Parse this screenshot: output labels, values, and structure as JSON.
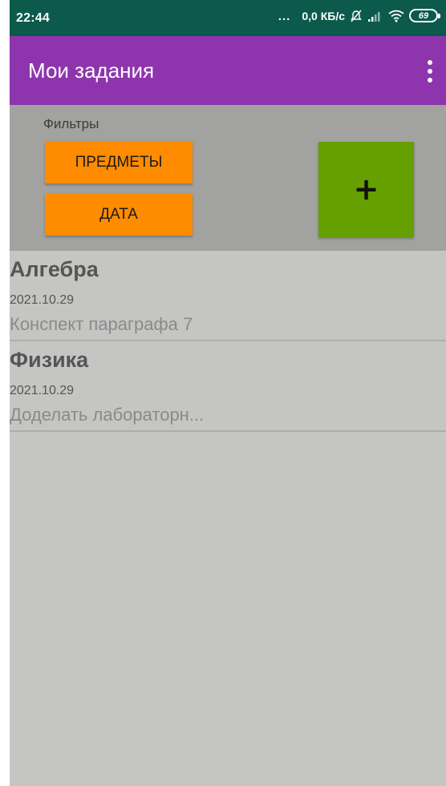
{
  "status_bar": {
    "time": "22:44",
    "more_dots": "...",
    "network_speed": "0,0 КБ/с",
    "battery_level": "69"
  },
  "app_bar": {
    "title": "Мои задания",
    "overflow_icon": "more-vert-icon"
  },
  "filters": {
    "label": "Фильтры",
    "subjects_button": "ПРЕДМЕТЫ",
    "date_button": "ДАТА",
    "add_button": "+"
  },
  "tasks": [
    {
      "subject": "Алгебра",
      "date": "2021.10.29",
      "description": "Конспект параграфа 7"
    },
    {
      "subject": "Физика",
      "date": "2021.10.29",
      "description": "Доделать лабораторн..."
    }
  ],
  "colors": {
    "status_bar": "#0c5a4c",
    "app_bar": "#8e35ad",
    "filter_panel": "#a2a2a1",
    "list_background": "#c5c5c3",
    "filter_button": "#ff8c00",
    "add_button": "#659f00"
  }
}
